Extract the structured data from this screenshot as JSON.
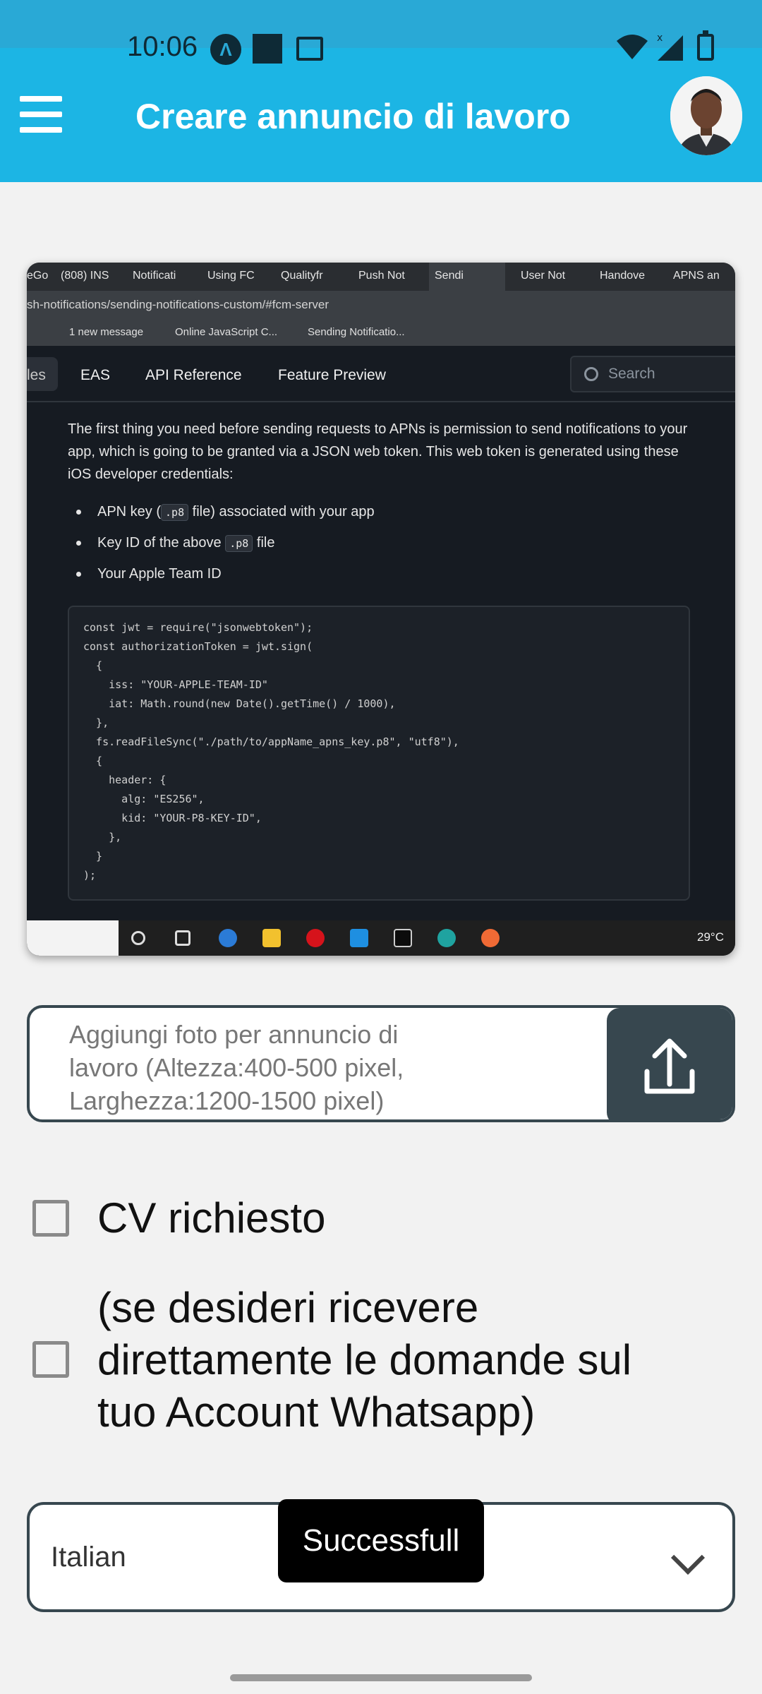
{
  "status_bar": {
    "time": "10:06"
  },
  "header": {
    "title": "Creare annuncio di lavoro"
  },
  "preview": {
    "tabs": [
      "eGo",
      "(808) INS",
      "Notificati",
      "Using FC",
      "Qualityfr",
      "Push Not",
      "Sendi",
      "User Not",
      "Handove",
      "APNS an"
    ],
    "url": "sh-notifications/sending-notifications-custom/#fcm-server",
    "bookmarks": [
      "1 new message",
      "Online JavaScript C...",
      "Sending Notificatio..."
    ],
    "nav": {
      "active": "les",
      "items": [
        "EAS",
        "API Reference",
        "Feature Preview"
      ],
      "search_placeholder": "Search"
    },
    "paragraph": "The first thing you need before sending requests to APNs is permission to send notifications to your app, which is going to be granted via a JSON web token. This web token is generated using these iOS developer credentials:",
    "bullets": [
      {
        "pre": "APN key (",
        "code": ".p8",
        "post": " file) associated with your app"
      },
      {
        "pre": "Key ID of the above ",
        "code": ".p8",
        "post": " file"
      },
      {
        "pre": "Your Apple Team ID",
        "code": "",
        "post": ""
      }
    ],
    "code_lines": [
      "const jwt = require(\"jsonwebtoken\");",
      "const authorizationToken = jwt.sign(",
      "  {",
      "    iss: \"YOUR-APPLE-TEAM-ID\"",
      "    iat: Math.round(new Date().getTime() / 1000),",
      "  },",
      "  fs.readFileSync(\"./path/to/appName_apns_key.p8\", \"utf8\"),",
      "  {",
      "    header: {",
      "      alg: \"ES256\",",
      "      kid: \"YOUR-P8-KEY-ID\",",
      "    },",
      "  }",
      ");"
    ],
    "taskbar_temp": "29°C"
  },
  "upload": {
    "placeholder": "Aggiungi foto per annuncio di lavoro (Altezza:400-500 pixel, Larghezza:1200-1500 pixel)"
  },
  "checkboxes": {
    "cv_label": "CV richiesto",
    "whatsapp_label": "(se desideri ricevere direttamente le domande sul tuo Account Whatsapp)"
  },
  "language_select": {
    "value": "Italian"
  },
  "toast": {
    "text": "Successfull"
  },
  "colors": {
    "header": "#1cb5e4",
    "statusbar": "#29a9d6",
    "dark_button": "#37474f"
  }
}
